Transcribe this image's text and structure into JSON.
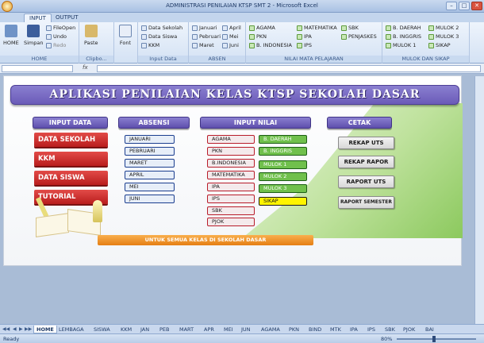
{
  "window": {
    "title": "ADMINISTRASI PENILAIAN KTSP SMT 2 - Microsoft Excel",
    "min": "–",
    "max": "□",
    "close": "✕"
  },
  "ribbon_tabs": [
    "INPUT",
    "OUTPUT"
  ],
  "ribbon": {
    "home": {
      "home_label": "HOME",
      "save_label": "Simpan",
      "fileopen": "FileOpen",
      "undo": "Undo",
      "redo": "Redo",
      "group": "HOME"
    },
    "clipboard": {
      "paste": "Paste",
      "group": "Clipbo..."
    },
    "font": {
      "label": "Font"
    },
    "input_data": {
      "items": [
        "Data Sekolah",
        "Data Siswa",
        "KKM"
      ],
      "group": "Input Data"
    },
    "absen": {
      "col1": [
        "Januari",
        "Pebruari",
        "Maret"
      ],
      "col2": [
        "April",
        "Mei",
        "Juni"
      ],
      "group": "ABSEN"
    },
    "nilai": {
      "col1": [
        "AGAMA",
        "PKN",
        "B. INDONESIA"
      ],
      "col2": [
        "MATEMATIKA",
        "IPA",
        "IPS"
      ],
      "col3": [
        "SBK",
        "PENJASKES"
      ],
      "group": "NILAI MATA PELAJARAN"
    },
    "mulok": {
      "col1": [
        "B. DAERAH",
        "B. INGGRIS",
        "MULOK 1"
      ],
      "col2": [
        "MULOK 2",
        "MULOK 3",
        "SIKAP"
      ],
      "group": "MULOK DAN SIKAP"
    }
  },
  "formula_bar": {
    "fx": "fx",
    "value": ""
  },
  "app": {
    "banner": "APLIKASI PENILAIAN KELAS KTSP SEKOLAH DASAR",
    "input_data": {
      "header": "INPUT DATA",
      "buttons": [
        "DATA SEKOLAH",
        "KKM",
        "DATA SISWA",
        "TUTORIAL"
      ]
    },
    "absensi": {
      "header": "ABSENSI",
      "months": [
        "JANUARI",
        "PEBRUARI",
        "MARET",
        "APRIL",
        "MEI",
        "JUNI"
      ]
    },
    "input_nilai": {
      "header": "INPUT NILAI",
      "subjects": [
        "AGAMA",
        "PKN",
        "B.INDONESIA",
        "MATEMATIKA",
        "IPA",
        "IPS",
        "SBK",
        "PJOK"
      ],
      "mulok": [
        "B. DAERAH",
        "B. INGGRIS",
        "MULOK 1",
        "MULOK 2",
        "MULOK 3",
        "SIKAP"
      ]
    },
    "cetak": {
      "header": "CETAK",
      "buttons": [
        "REKAP UTS",
        "REKAP RAPOR",
        "RAPORT UTS",
        "RAPORT SEMESTER"
      ]
    },
    "footer_banner": "UNTUK SEMUA KELAS DI SEKOLAH DASAR"
  },
  "sheet_tabs": [
    "HOME",
    "LEMBAGA",
    "SISWA",
    "KKM",
    "JAN",
    "PEB",
    "MART",
    "APR",
    "MEI",
    "JUN",
    "AGAMA",
    "PKN",
    "BIND",
    "MTK",
    "IPA",
    "IPS",
    "SBK",
    "PJOK",
    "BAI"
  ],
  "status": {
    "ready": "Ready",
    "zoom": "80%"
  },
  "colors": {
    "accent": "#6b5bb8",
    "red": "#c42323",
    "green": "#70c04c",
    "yellow": "#fff400",
    "orange": "#ef8e22"
  }
}
